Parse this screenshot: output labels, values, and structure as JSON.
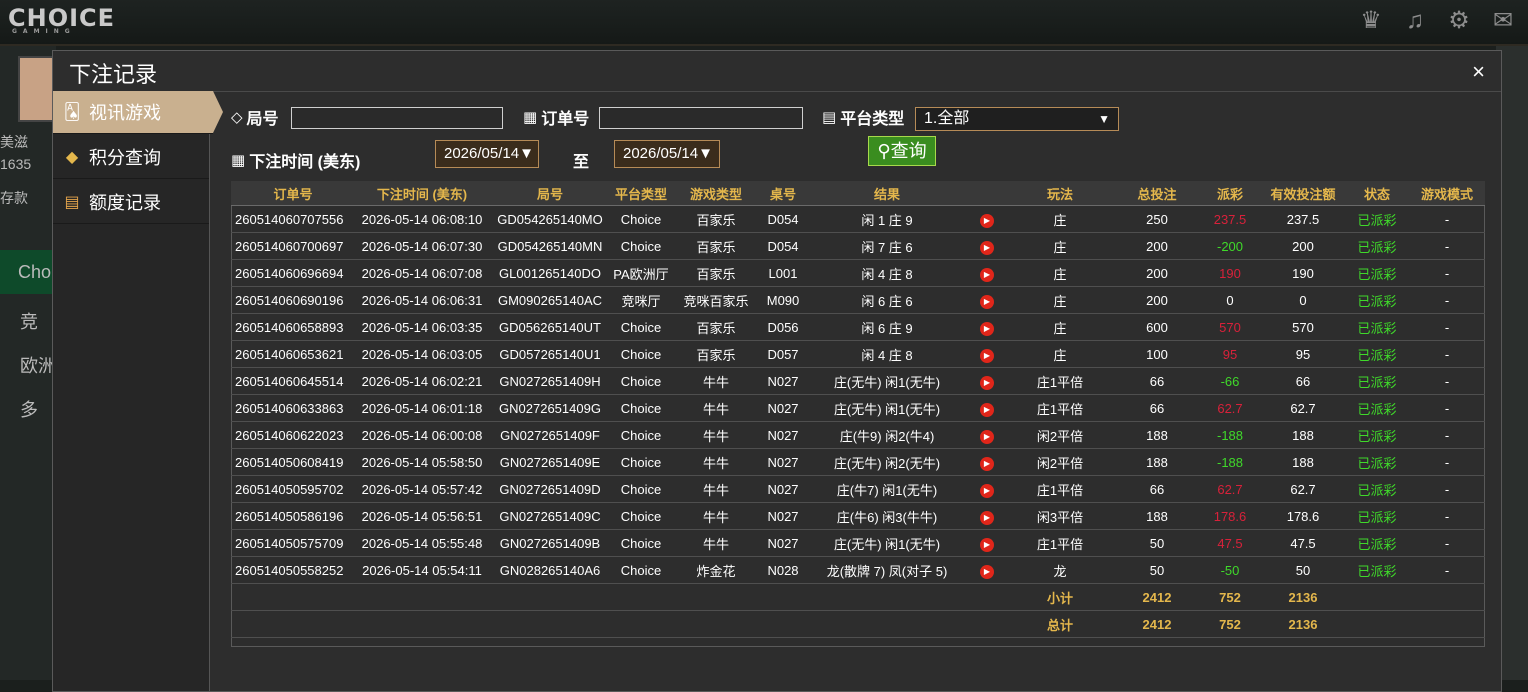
{
  "app": {
    "logo": "CHOICE",
    "logo_sub": "GAMING",
    "icons": [
      "vip-icon",
      "music-icon",
      "gear-icon",
      "chat-icon"
    ]
  },
  "background": {
    "texts": [
      "美滋",
      "1635",
      "存款",
      "Cho",
      "竞",
      "欧洲",
      "多"
    ]
  },
  "modal": {
    "title": "下注记录",
    "close": "×"
  },
  "sidenav": {
    "items": [
      {
        "label": "视讯游戏",
        "icon": "cards-icon",
        "active": true
      },
      {
        "label": "积分查询",
        "icon": "diamond-icon",
        "active": false
      },
      {
        "label": "额度记录",
        "icon": "document-icon",
        "active": false
      }
    ]
  },
  "filters": {
    "round_label": "局号",
    "round_value": "",
    "order_label": "订单号",
    "order_value": "",
    "platform_label": "平台类型",
    "platform_value": "1.全部",
    "time_label": "下注时间 (美东)",
    "date_from": "2026/05/14▼",
    "to_label": "至",
    "date_to": "2026/05/14▼",
    "query_label": "查询"
  },
  "table": {
    "columns": [
      "订单号",
      "下注时间 (美东)",
      "局号",
      "平台类型",
      "游戏类型",
      "桌号",
      "结果",
      "",
      "玩法",
      "总投注",
      "派彩",
      "有效投注额",
      "状态",
      "游戏模式"
    ],
    "rows": [
      [
        "260514060707556",
        "2026-05-14 06:08:10",
        "GD054265140MO",
        "Choice",
        "百家乐",
        "D054",
        "闲 1 庄 9",
        "庄",
        "250",
        "237.5",
        "237.5",
        "已派彩",
        "-"
      ],
      [
        "260514060700697",
        "2026-05-14 06:07:30",
        "GD054265140MN",
        "Choice",
        "百家乐",
        "D054",
        "闲 7 庄 6",
        "庄",
        "200",
        "-200",
        "200",
        "已派彩",
        "-"
      ],
      [
        "260514060696694",
        "2026-05-14 06:07:08",
        "GL001265140DO",
        "PA欧洲厅",
        "百家乐",
        "L001",
        "闲 4 庄 8",
        "庄",
        "200",
        "190",
        "190",
        "已派彩",
        "-"
      ],
      [
        "260514060690196",
        "2026-05-14 06:06:31",
        "GM090265140AC",
        "竞咪厅",
        "竞咪百家乐",
        "M090",
        "闲 6 庄 6",
        "庄",
        "200",
        "0",
        "0",
        "已派彩",
        "-"
      ],
      [
        "260514060658893",
        "2026-05-14 06:03:35",
        "GD056265140UT",
        "Choice",
        "百家乐",
        "D056",
        "闲 6 庄 9",
        "庄",
        "600",
        "570",
        "570",
        "已派彩",
        "-"
      ],
      [
        "260514060653621",
        "2026-05-14 06:03:05",
        "GD057265140U1",
        "Choice",
        "百家乐",
        "D057",
        "闲 4 庄 8",
        "庄",
        "100",
        "95",
        "95",
        "已派彩",
        "-"
      ],
      [
        "260514060645514",
        "2026-05-14 06:02:21",
        "GN0272651409H",
        "Choice",
        "牛牛",
        "N027",
        "庄(无牛) 闲1(无牛)",
        "庄1平倍",
        "66",
        "-66",
        "66",
        "已派彩",
        "-"
      ],
      [
        "260514060633863",
        "2026-05-14 06:01:18",
        "GN0272651409G",
        "Choice",
        "牛牛",
        "N027",
        "庄(无牛) 闲1(无牛)",
        "庄1平倍",
        "66",
        "62.7",
        "62.7",
        "已派彩",
        "-"
      ],
      [
        "260514060622023",
        "2026-05-14 06:00:08",
        "GN0272651409F",
        "Choice",
        "牛牛",
        "N027",
        "庄(牛9) 闲2(牛4)",
        "闲2平倍",
        "188",
        "-188",
        "188",
        "已派彩",
        "-"
      ],
      [
        "260514050608419",
        "2026-05-14 05:58:50",
        "GN0272651409E",
        "Choice",
        "牛牛",
        "N027",
        "庄(无牛) 闲2(无牛)",
        "闲2平倍",
        "188",
        "-188",
        "188",
        "已派彩",
        "-"
      ],
      [
        "260514050595702",
        "2026-05-14 05:57:42",
        "GN0272651409D",
        "Choice",
        "牛牛",
        "N027",
        "庄(牛7) 闲1(无牛)",
        "庄1平倍",
        "66",
        "62.7",
        "62.7",
        "已派彩",
        "-"
      ],
      [
        "260514050586196",
        "2026-05-14 05:56:51",
        "GN0272651409C",
        "Choice",
        "牛牛",
        "N027",
        "庄(牛6) 闲3(牛牛)",
        "闲3平倍",
        "188",
        "178.6",
        "178.6",
        "已派彩",
        "-"
      ],
      [
        "260514050575709",
        "2026-05-14 05:55:48",
        "GN0272651409B",
        "Choice",
        "牛牛",
        "N027",
        "庄(无牛) 闲1(无牛)",
        "庄1平倍",
        "50",
        "47.5",
        "47.5",
        "已派彩",
        "-"
      ],
      [
        "260514050558252",
        "2026-05-14 05:54:11",
        "GN028265140A6",
        "Choice",
        "炸金花",
        "N028",
        "龙(散牌 7) 凤(对子 5)",
        "龙",
        "50",
        "-50",
        "50",
        "已派彩",
        "-"
      ]
    ],
    "subtotal": {
      "label": "小计",
      "total_bet": "2412",
      "payout": "752",
      "valid": "2136"
    },
    "total": {
      "label": "总计",
      "total_bet": "2412",
      "payout": "752",
      "valid": "2136"
    }
  },
  "colors": {
    "header_text": "#e4b74c",
    "negative": "#3fd92a",
    "positive": "#d8213a",
    "active_nav": "#c9b08f",
    "query_button": "#3a8d1f"
  }
}
